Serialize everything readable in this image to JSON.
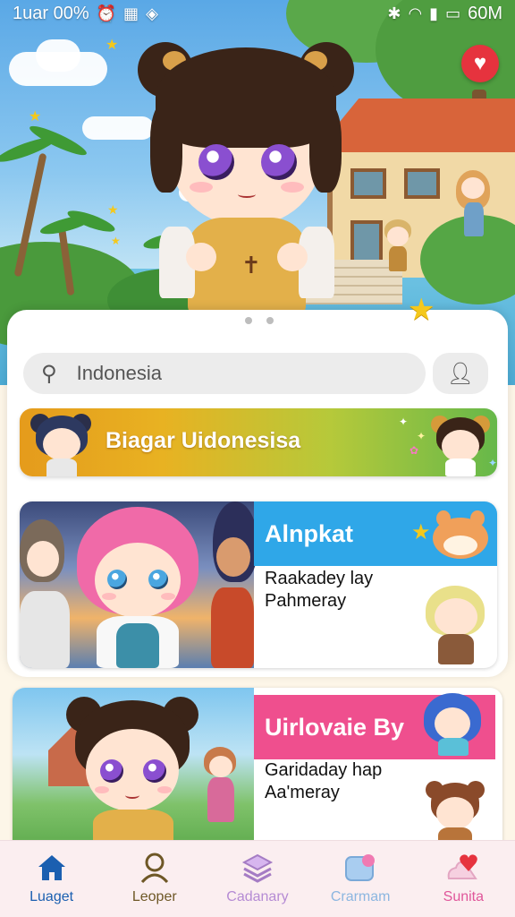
{
  "status_bar": {
    "left_text": "1uar 00%",
    "right_text": "60M"
  },
  "search": {
    "value": "Indonesia"
  },
  "banner": {
    "title": "Biagar Uidonesisa"
  },
  "cards": [
    {
      "caption": "Alnpkat",
      "line1": "Raakadey lay",
      "line2": "Pahmeray",
      "caption_color": "#2fa7e8"
    },
    {
      "caption": "Uirlovaie By",
      "line1": "Garidaday hap",
      "line2": "Aa'meray",
      "caption_color": "#ef4f8e"
    }
  ],
  "bottom_nav": [
    {
      "label": "Luaget",
      "icon": "home-icon",
      "color": "#1b5fb0"
    },
    {
      "label": "Leoper",
      "icon": "person-icon",
      "color": "#6e5726"
    },
    {
      "label": "Cadanary",
      "icon": "stack-icon",
      "color": "#b58bd4"
    },
    {
      "label": "Crarmam",
      "icon": "chat-icon",
      "color": "#8cb6e0"
    },
    {
      "label": "Sunita",
      "icon": "heart-cloud-icon",
      "color": "#e0569a"
    }
  ],
  "colors": {
    "accent_heart": "#e6333e",
    "star": "#f4c81c"
  }
}
